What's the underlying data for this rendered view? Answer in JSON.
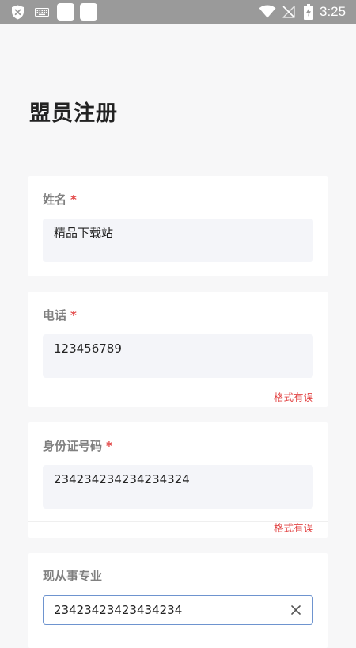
{
  "status_bar": {
    "time": "3:25",
    "background_color": "#9a9a9a",
    "left_icons": [
      "shield-x-icon",
      "keyboard-icon",
      "app-square-icon",
      "app-square-icon"
    ],
    "right_icons": [
      "wifi-icon",
      "no-signal-icon",
      "battery-charging-icon"
    ]
  },
  "page": {
    "title": "盟员注册",
    "background_color": "#f7f7f8"
  },
  "form": {
    "required_mark": "*",
    "required_color": "#e24545",
    "error_color": "#e24545",
    "focus_border_color": "#6e94cf",
    "input_background_color": "#f4f5f9",
    "fields": [
      {
        "label": "姓名",
        "required": true,
        "value": "精品下载站"
      },
      {
        "label": "电话",
        "required": true,
        "value": "123456789",
        "error": "格式有误"
      },
      {
        "label": "身份证号码",
        "required": true,
        "value": "234234234234234324",
        "error": "格式有误"
      },
      {
        "label": "现从事专业",
        "required": false,
        "value": "23423423423434234",
        "focused": true,
        "clear_icon": "close-icon"
      }
    ]
  }
}
